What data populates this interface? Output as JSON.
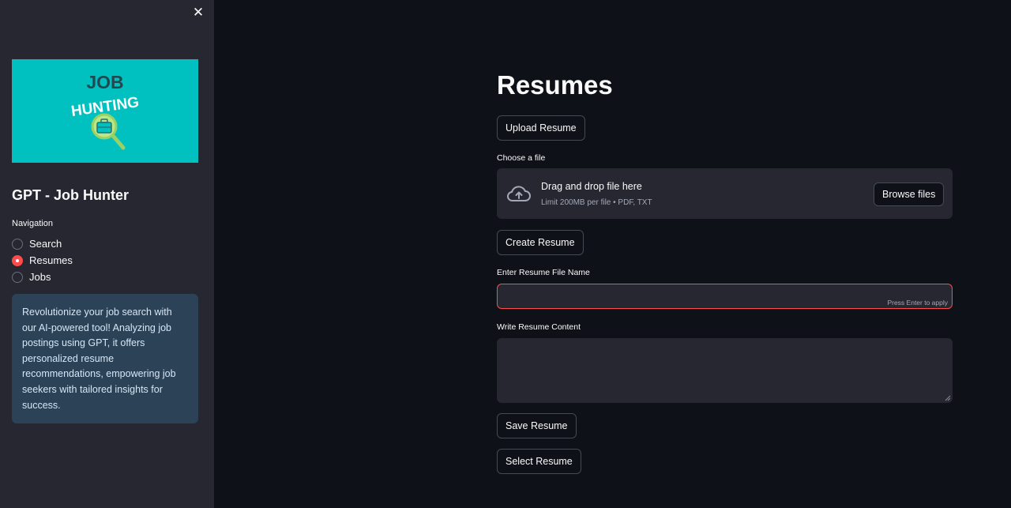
{
  "sidebar": {
    "close_icon": "close-icon",
    "logo": {
      "line1": "JOB",
      "line2": "HUNTING",
      "icon": "magnifier-briefcase-icon",
      "background_color": "#00c1c0"
    },
    "app_title": "GPT - Job Hunter",
    "navigation": {
      "label": "Navigation",
      "items": [
        {
          "label": "Search",
          "selected": false
        },
        {
          "label": "Resumes",
          "selected": true
        },
        {
          "label": "Jobs",
          "selected": false
        }
      ]
    },
    "info_text": "Revolutionize your job search with our AI-powered tool! Analyzing job postings using GPT, it offers personalized resume recommendations, empowering job seekers with tailored insights for success."
  },
  "main": {
    "title": "Resumes",
    "upload_button": "Upload Resume",
    "file_uploader": {
      "label": "Choose a file",
      "icon": "cloud-upload-icon",
      "title": "Drag and drop file here",
      "subtitle": "Limit 200MB per file • PDF, TXT",
      "browse_button": "Browse files"
    },
    "create_button": "Create Resume",
    "file_name_field": {
      "label": "Enter Resume File Name",
      "value": "",
      "hint": "Press Enter to apply"
    },
    "content_field": {
      "label": "Write Resume Content",
      "value": ""
    },
    "save_button": "Save Resume",
    "select_button": "Select Resume"
  },
  "colors": {
    "accent": "#ff4b4b",
    "sidebar_bg": "#262730",
    "main_bg": "#0e1117",
    "info_bg": "#2c4257"
  }
}
